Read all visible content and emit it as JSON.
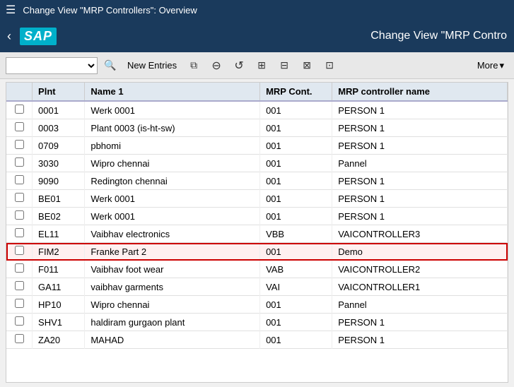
{
  "titleBar": {
    "hamburger": "☰",
    "text": "Change View \"MRP Controllers\": Overview"
  },
  "navBar": {
    "backArrow": "‹",
    "logoText": "SAP",
    "title": "Change View \"MRP Contro"
  },
  "toolbar": {
    "selectPlaceholder": "",
    "newEntriesLabel": "New Entries",
    "moreLabel": "More",
    "moreArrow": "▾"
  },
  "table": {
    "headers": [
      "",
      "Plnt",
      "Name 1",
      "MRP Cont.",
      "MRP controller name"
    ],
    "rows": [
      {
        "plnt": "0001",
        "name": "Werk 0001",
        "mrp": "001",
        "mrpname": "PERSON 1",
        "selected": false
      },
      {
        "plnt": "0003",
        "name": "Plant 0003 (is-ht-sw)",
        "mrp": "001",
        "mrpname": "PERSON 1",
        "selected": false
      },
      {
        "plnt": "0709",
        "name": "pbhomi",
        "mrp": "001",
        "mrpname": "PERSON 1",
        "selected": false
      },
      {
        "plnt": "3030",
        "name": "Wipro chennai",
        "mrp": "001",
        "mrpname": "Pannel",
        "selected": false
      },
      {
        "plnt": "9090",
        "name": "Redington chennai",
        "mrp": "001",
        "mrpname": "PERSON 1",
        "selected": false
      },
      {
        "plnt": "BE01",
        "name": "Werk 0001",
        "mrp": "001",
        "mrpname": "PERSON 1",
        "selected": false
      },
      {
        "plnt": "BE02",
        "name": "Werk 0001",
        "mrp": "001",
        "mrpname": "PERSON 1",
        "selected": false
      },
      {
        "plnt": "EL11",
        "name": "Vaibhav electronics",
        "mrp": "VBB",
        "mrpname": "VAICONTROLLER3",
        "selected": false
      },
      {
        "plnt": "FIM2",
        "name": "Franke Part 2",
        "mrp": "001",
        "mrpname": "Demo",
        "selected": true
      },
      {
        "plnt": "F011",
        "name": "Vaibhav foot wear",
        "mrp": "VAB",
        "mrpname": "VAICONTROLLER2",
        "selected": false
      },
      {
        "plnt": "GA11",
        "name": "vaibhav garments",
        "mrp": "VAI",
        "mrpname": "VAICONTROLLER1",
        "selected": false
      },
      {
        "plnt": "HP10",
        "name": "Wipro chennai",
        "mrp": "001",
        "mrpname": "Pannel",
        "selected": false
      },
      {
        "plnt": "SHV1",
        "name": "haldiram gurgaon plant",
        "mrp": "001",
        "mrpname": "PERSON 1",
        "selected": false
      },
      {
        "plnt": "ZA20",
        "name": "MAHAD",
        "mrp": "001",
        "mrpname": "PERSON 1",
        "selected": false
      }
    ]
  }
}
